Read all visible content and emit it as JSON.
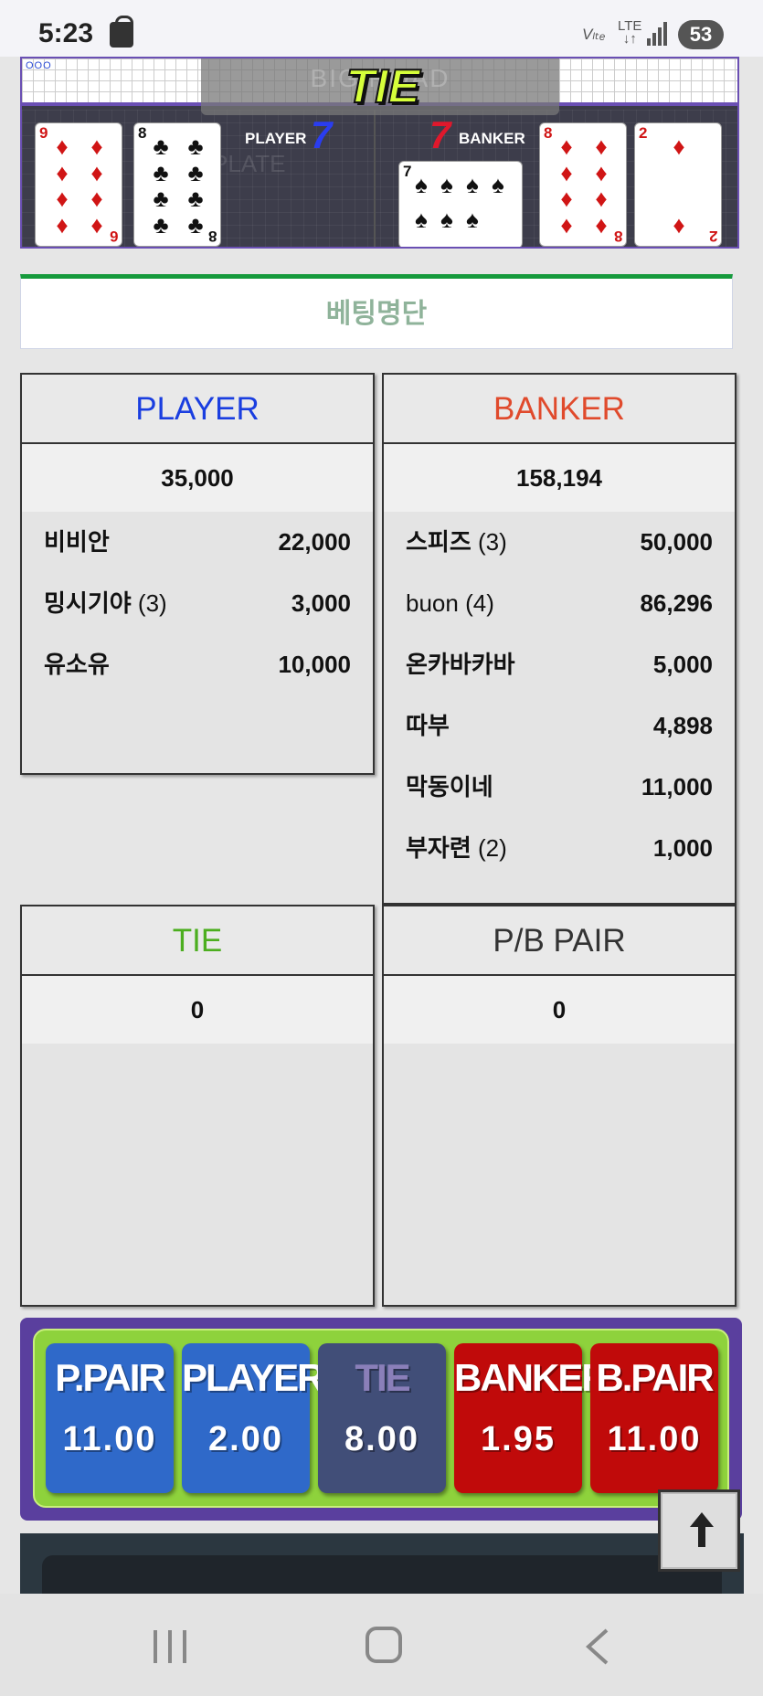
{
  "status_bar": {
    "time": "5:23",
    "volte": "Vₗₜₑ",
    "lte": "LTE",
    "battery": "53"
  },
  "game": {
    "road_marks": "OOO",
    "big_road_label": "BIG ROAD",
    "plate_label": "PLATE",
    "result_banner": "TIE",
    "player_label": "PLAYER",
    "player_score": "7",
    "banker_label": "BANKER",
    "banker_score": "7",
    "player_cards": [
      {
        "rank": "9",
        "suit": "♦",
        "color": "#d01515"
      },
      {
        "rank": "8",
        "suit": "♣",
        "color": "#111111"
      }
    ],
    "banker_cards": [
      {
        "rank": "7",
        "suit": "♠",
        "color": "#111111",
        "sideways": true
      },
      {
        "rank": "8",
        "suit": "♦",
        "color": "#d01515"
      },
      {
        "rank": "2",
        "suit": "♦",
        "color": "#d01515"
      }
    ]
  },
  "betting_list": {
    "title": "베팅명단"
  },
  "panels": {
    "player": {
      "title": "PLAYER",
      "title_color": "#1a3ee0",
      "total": "35,000",
      "rows": [
        {
          "name": "비비안",
          "count": "",
          "amount": "22,000"
        },
        {
          "name": "밍시기야",
          "count": "(3)",
          "amount": "3,000"
        },
        {
          "name": "유소유",
          "count": "",
          "amount": "10,000"
        }
      ]
    },
    "banker": {
      "title": "BANKER",
      "title_color": "#e04a2c",
      "total": "158,194",
      "rows": [
        {
          "name": "스피즈",
          "count": "(3)",
          "amount": "50,000"
        },
        {
          "name": "buon",
          "count": "(4)",
          "amount": "86,296"
        },
        {
          "name": "온카바카바",
          "count": "",
          "amount": "5,000"
        },
        {
          "name": "따부",
          "count": "",
          "amount": "4,898"
        },
        {
          "name": "막동이네",
          "count": "",
          "amount": "11,000"
        },
        {
          "name": "부자련",
          "count": "(2)",
          "amount": "1,000"
        }
      ]
    },
    "tie": {
      "title": "TIE",
      "title_color": "#4cae1f",
      "total": "0"
    },
    "pair": {
      "title": "P/B PAIR",
      "title_color": "#333333",
      "total": "0"
    }
  },
  "odds": [
    {
      "label": "P.PAIR",
      "value": "11.00",
      "style": "blue"
    },
    {
      "label": "PLAYER",
      "value": "2.00",
      "style": "blue"
    },
    {
      "label": "TIE",
      "value": "8.00",
      "style": "slate"
    },
    {
      "label": "BANKER",
      "value": "1.95",
      "style": "crimson"
    },
    {
      "label": "B.PAIR",
      "value": "11.00",
      "style": "crimson"
    }
  ],
  "icons": {
    "scroll_top": "arrow-up-icon",
    "nav_recent": "recent-apps-icon",
    "nav_home": "home-icon",
    "nav_back": "back-icon"
  }
}
